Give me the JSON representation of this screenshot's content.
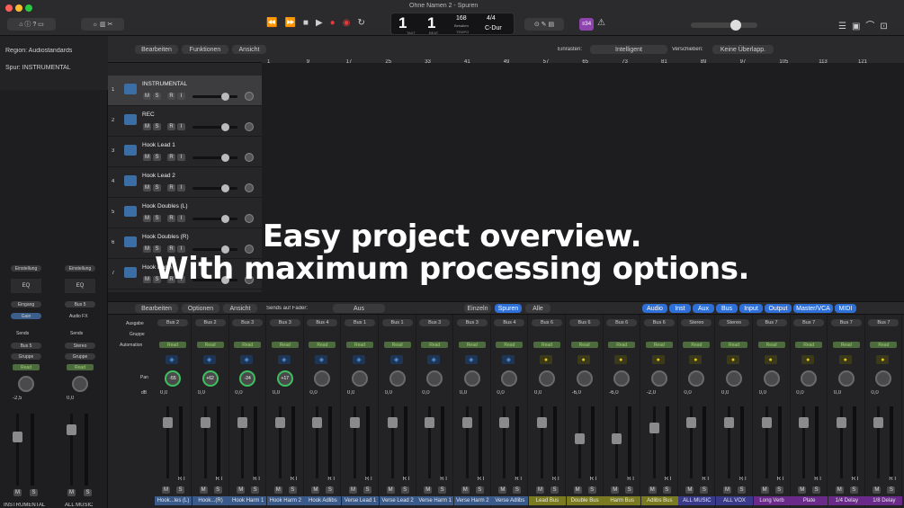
{
  "window": {
    "title": "Ohne Namen 2 - Spuren"
  },
  "lcd": {
    "takt": "1",
    "beat": "1",
    "takt_label": "TAKT",
    "beat_label": "BEAT",
    "tempo": "168",
    "tempo_label": "TEMPO",
    "behalten": "Behalten",
    "sig": "4/4",
    "key": "C-Dur",
    "badge": "≡34"
  },
  "inspector": {
    "region": "Region: Audiostandards",
    "spur": "Spur: INSTRUMENTAL",
    "einstellung": "Einstellung",
    "eq": "EQ",
    "eingang": "Eingang",
    "gain": "Gain",
    "bus5": "Bus 5",
    "audiofx": "Audio FX",
    "sends": "Sends",
    "stereo": "Stereo",
    "gruppe": "Gruppe",
    "read": "Read",
    "val1": "-2,5",
    "val2": "0,0",
    "name1": "INSTRUMENTAL",
    "name2": "ALL MUSIC",
    "m": "M",
    "s": "S"
  },
  "trackbar": {
    "bearbeiten": "Bearbeiten",
    "funktionen": "Funktionen",
    "ansicht": "Ansicht",
    "einrasten_label": "Einrasten:",
    "einrasten": "Intelligent",
    "verschieben_label": "Verschieben:",
    "verschieben": "Keine Überlapp.",
    "add": "+"
  },
  "ruler": [
    "1",
    "9",
    "17",
    "25",
    "33",
    "41",
    "49",
    "57",
    "65",
    "73",
    "81",
    "89",
    "97",
    "105",
    "113",
    "121"
  ],
  "tracks": [
    {
      "num": "1",
      "name": "INSTRUMENTAL"
    },
    {
      "num": "2",
      "name": "REC"
    },
    {
      "num": "3",
      "name": "Hook Lead 1"
    },
    {
      "num": "4",
      "name": "Hook Lead 2"
    },
    {
      "num": "5",
      "name": "Hook Doubles (L)"
    },
    {
      "num": "6",
      "name": "Hook Doubles (R)"
    },
    {
      "num": "7",
      "name": "Hook Harm 1"
    }
  ],
  "mixerbar": {
    "bearbeiten": "Bearbeiten",
    "optionen": "Optionen",
    "ansicht": "Ansicht",
    "sends_label": "Sends auf Fader:",
    "aus": "Aus",
    "einzeln": "Einzeln",
    "spuren": "Spuren",
    "alle": "Alle",
    "audio": "Audio",
    "inst": "Inst",
    "aux": "Aux",
    "bus": "Bus",
    "input": "Input",
    "output": "Output",
    "master": "Master/VCA",
    "midi": "MIDI"
  },
  "mixer_labels": {
    "ausgabe": "Ausgabe",
    "gruppe": "Gruppe",
    "automation": "Automation",
    "pan": "Pan",
    "db": "dB"
  },
  "strips": [
    {
      "out": "Bus 2",
      "pan": "-55",
      "db": "0,0",
      "name": "Hook...les (L)",
      "color": "#3a5a8a"
    },
    {
      "out": "Bus 2",
      "pan": "+62",
      "db": "0,0",
      "name": "Hook...(R)",
      "color": "#3a5a8a"
    },
    {
      "out": "Bus 3",
      "pan": "-24",
      "db": "0,0",
      "name": "Hook Harm 1",
      "color": "#3a5a8a"
    },
    {
      "out": "Bus 3",
      "pan": "+17",
      "db": "0,0",
      "name": "Hook Harm 2",
      "color": "#3a5a8a"
    },
    {
      "out": "Bus 4",
      "pan": "",
      "db": "0,0",
      "name": "Hook Adlibs",
      "color": "#3a5a8a"
    },
    {
      "out": "Bus 1",
      "pan": "",
      "db": "0,0",
      "name": "Verse Lead 1",
      "color": "#3a5a8a"
    },
    {
      "out": "Bus 1",
      "pan": "",
      "db": "0,0",
      "name": "Verse Lead 2",
      "color": "#3a5a8a"
    },
    {
      "out": "Bus 3",
      "pan": "",
      "db": "0,0",
      "name": "Verse Harm 1",
      "color": "#3a5a8a"
    },
    {
      "out": "Bus 3",
      "pan": "",
      "db": "0,0",
      "name": "Verse Harm 2",
      "color": "#3a5a8a"
    },
    {
      "out": "Bus 4",
      "pan": "",
      "db": "0,0",
      "name": "Verse Adlibs",
      "color": "#3a5a8a"
    },
    {
      "out": "Bus 6",
      "pan": "",
      "db": "0,0",
      "name": "Lead Bus",
      "color": "#7a7a20"
    },
    {
      "out": "Bus 6",
      "pan": "",
      "db": "-6,0",
      "name": "Double Bus",
      "color": "#7a7a20"
    },
    {
      "out": "Bus 6",
      "pan": "",
      "db": "-6,0",
      "name": "Harm Bus",
      "color": "#7a7a20"
    },
    {
      "out": "Bus 6",
      "pan": "",
      "db": "-2,0",
      "name": "Adlibs Bus",
      "color": "#7a7a20"
    },
    {
      "out": "Stereo",
      "pan": "",
      "db": "0,0",
      "name": "ALL MUSIC",
      "color": "#3a3a8a"
    },
    {
      "out": "Stereo",
      "pan": "",
      "db": "0,0",
      "name": "ALL VOX",
      "color": "#3a3a8a"
    },
    {
      "out": "Bus 7",
      "pan": "",
      "db": "0,0",
      "name": "Long Verb",
      "color": "#6a2a8a"
    },
    {
      "out": "Bus 7",
      "pan": "",
      "db": "0,0",
      "name": "Plate",
      "color": "#6a2a8a"
    },
    {
      "out": "Bus 7",
      "pan": "",
      "db": "0,0",
      "name": "1/4 Delay",
      "color": "#6a2a8a"
    },
    {
      "out": "Bus 7",
      "pan": "",
      "db": "0,0",
      "name": "1/8 Delay",
      "color": "#6a2a8a"
    }
  ],
  "overlay": {
    "line1": "Easy project overview.",
    "line2": "With maximum processing options."
  }
}
